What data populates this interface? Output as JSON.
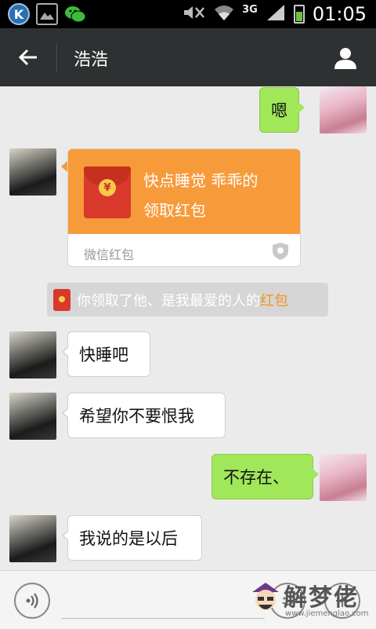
{
  "status_bar": {
    "network": "3G",
    "time": "01:05",
    "app_icons": [
      "kuaibo-k-icon",
      "gallery-icon",
      "wechat-icon"
    ],
    "k_letter": "K"
  },
  "header": {
    "title": "浩浩",
    "back_glyph": "←"
  },
  "messages": [
    {
      "side": "right",
      "text": "嗯"
    },
    {
      "side": "left",
      "type": "red_packet",
      "line1": "快点睡觉 乖乖的",
      "line2": "领取红包",
      "footer": "微信红包",
      "coin": "¥"
    },
    {
      "side": "system",
      "text_prefix": "你领取了他、是我最爱的人的",
      "text_highlight": "红包"
    },
    {
      "side": "left",
      "text": "快睡吧"
    },
    {
      "side": "left",
      "text": "希望你不要恨我"
    },
    {
      "side": "right",
      "text": "不存在、"
    },
    {
      "side": "left",
      "text": "我说的是以后"
    }
  ],
  "watermark": {
    "text": "解梦佬",
    "url": "www.jiemenglao.com"
  },
  "colors": {
    "title_bar": "#2e3132",
    "sent_bubble": "#a0e75a",
    "red_packet": "#f79a3a",
    "highlight": "#f7931e"
  }
}
